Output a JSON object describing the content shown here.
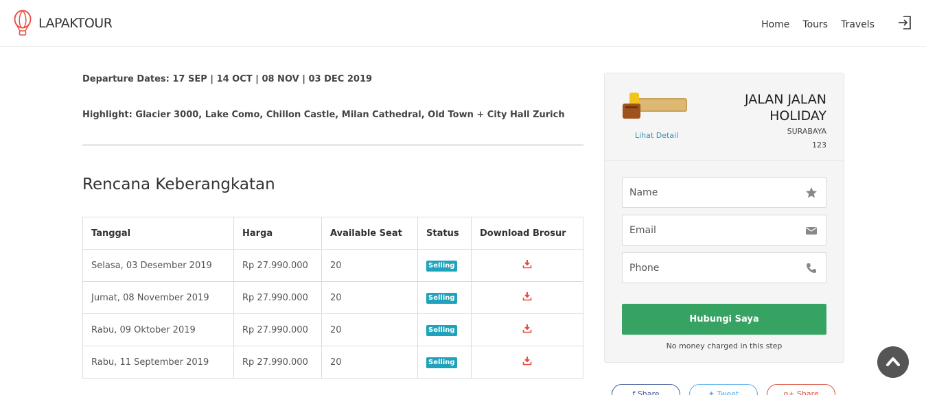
{
  "header": {
    "brand": "LAPAKTOUR",
    "nav": [
      {
        "label": "Home"
      },
      {
        "label": "Tours"
      },
      {
        "label": "Travels"
      }
    ]
  },
  "tour": {
    "departure_dates": "Departure Dates: 17 SEP | 14 OCT | 08 NOV | 03 DEC 2019",
    "highlight": "Highlight: Glacier 3000, Lake Como, Chillon Castle, Milan Cathedral, Old Town + City Hall Zurich"
  },
  "schedule": {
    "title": "Rencana Keberangkatan",
    "columns": [
      "Tanggal",
      "Harga",
      "Available Seat",
      "Status",
      "Download Brosur"
    ],
    "rows": [
      {
        "date": "Selasa, 03 Desember 2019",
        "price": "Rp 27.990.000",
        "seat": "20",
        "status": "Selling"
      },
      {
        "date": "Jumat, 08 November 2019",
        "price": "Rp 27.990.000",
        "seat": "20",
        "status": "Selling"
      },
      {
        "date": "Rabu, 09 Oktober 2019",
        "price": "Rp 27.990.000",
        "seat": "20",
        "status": "Selling"
      },
      {
        "date": "Rabu, 11 September 2019",
        "price": "Rp 27.990.000",
        "seat": "20",
        "status": "Selling"
      }
    ]
  },
  "agent": {
    "logo_text": "jalan-jalan holiday",
    "detail_link": "Lihat Detail",
    "name": "JALAN JALAN HOLIDAY",
    "city": "SURABAYA",
    "code": "123"
  },
  "contact_form": {
    "name_placeholder": "Name",
    "email_placeholder": "Email",
    "phone_placeholder": "Phone",
    "submit_label": "Hubungi Saya",
    "note": "No money charged in this step"
  },
  "share": {
    "facebook": "Share",
    "twitter": "Tweet",
    "google": "Share"
  },
  "colors": {
    "accent_green": "#36a363",
    "badge_teal": "#1fa2bc",
    "download_red": "#e74c3c",
    "logo_red": "#e8534a"
  }
}
